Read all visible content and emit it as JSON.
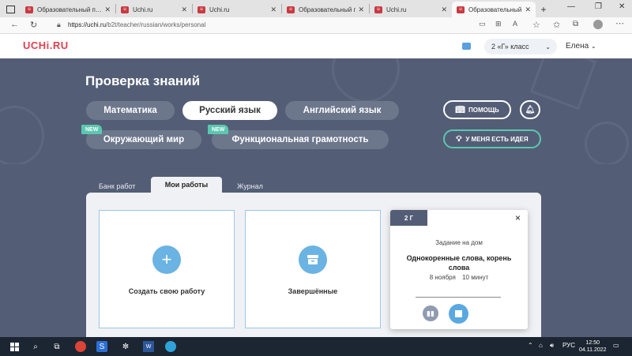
{
  "browser": {
    "tabs": [
      {
        "label": "Образовательный п…",
        "active": false
      },
      {
        "label": "Uchi.ru",
        "active": false
      },
      {
        "label": "Uchi.ru",
        "active": false
      },
      {
        "label": "Образовательный п…",
        "active": false
      },
      {
        "label": "Uchi.ru",
        "active": false
      },
      {
        "label": "Образовательный п…",
        "active": true
      }
    ],
    "new_tab_symbol": "+",
    "url_host": "https://uchi.ru",
    "url_path": "/b2t/teacher/russian/works/personal"
  },
  "header": {
    "logo": "UCHi.RU",
    "class_selector": "2 «Г» класс",
    "user_name": "Елена"
  },
  "hero": {
    "title": "Проверка знаний",
    "subjects": [
      {
        "label": "Математика",
        "active": false,
        "new": false
      },
      {
        "label": "Русский язык",
        "active": true,
        "new": false
      },
      {
        "label": "Английский язык",
        "active": false,
        "new": false
      },
      {
        "label": "Окружающий мир",
        "active": false,
        "new": true
      },
      {
        "label": "Функциональная грамотность",
        "active": false,
        "new": true
      }
    ],
    "new_badge": "NEW",
    "help_button": "ПОМОЩЬ",
    "idea_button": "У МЕНЯ ЕСТЬ ИДЕЯ"
  },
  "section_tabs": [
    {
      "label": "Банк работ",
      "active": false
    },
    {
      "label": "Мои работы",
      "active": true
    },
    {
      "label": "Журнал",
      "active": false
    }
  ],
  "cards": [
    {
      "label": "Создать свою работу",
      "icon": "plus-icon"
    },
    {
      "label": "Завершённые",
      "icon": "archive-icon"
    }
  ],
  "popup": {
    "badge": "2 Г",
    "close": "×",
    "type": "Задание на дом",
    "title": "Однокоренные слова, корень слова",
    "date": "8 ноября",
    "duration": "10 минут"
  },
  "taskbar": {
    "lang": "РУС",
    "time": "12:50",
    "date": "04.11.2022"
  },
  "colors": {
    "hero_bg": "#535e76",
    "brand": "#e0414e",
    "new_badge": "#5cc7b0",
    "accent_blue": "#6ab3e3"
  }
}
